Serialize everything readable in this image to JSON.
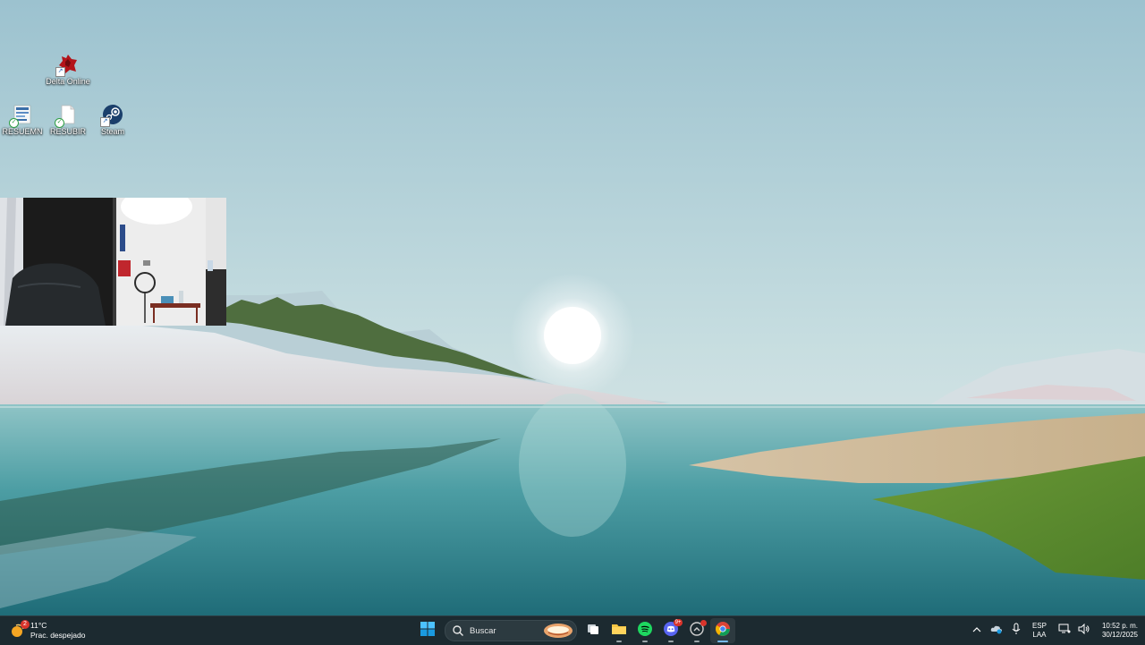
{
  "desktop": {
    "icons": [
      {
        "label": "Delta Online",
        "icon": "delta-online-icon"
      },
      {
        "label": "RESUEMN",
        "icon": "document-thumbnail-icon"
      },
      {
        "label": "RESUBIR",
        "icon": "document-icon"
      },
      {
        "label": "Steam",
        "icon": "steam-icon"
      }
    ]
  },
  "taskbar": {
    "weather": {
      "temp": "11°C",
      "desc": "Prac. despejado",
      "badge": "2"
    },
    "search": {
      "label": "Buscar"
    },
    "apps": [
      {
        "name": "start",
        "icon": "windows-start-icon"
      },
      {
        "name": "search",
        "icon": "search-icon"
      },
      {
        "name": "task-view",
        "icon": "task-view-icon"
      },
      {
        "name": "file-explorer",
        "icon": "folder-icon"
      },
      {
        "name": "spotify",
        "icon": "spotify-icon"
      },
      {
        "name": "discord",
        "icon": "discord-icon",
        "badge": "9+"
      },
      {
        "name": "app-with-alert",
        "icon": "app-icon"
      },
      {
        "name": "chrome",
        "icon": "chrome-icon",
        "active": true
      }
    ],
    "tray": {
      "lang_line1": "ESP",
      "lang_line2": "LAA",
      "time": "10:52 p. m.",
      "date": "30/12/2025"
    }
  },
  "colors": {
    "taskbar_bg": "#1c2a30",
    "accent": "#76b9ed"
  }
}
